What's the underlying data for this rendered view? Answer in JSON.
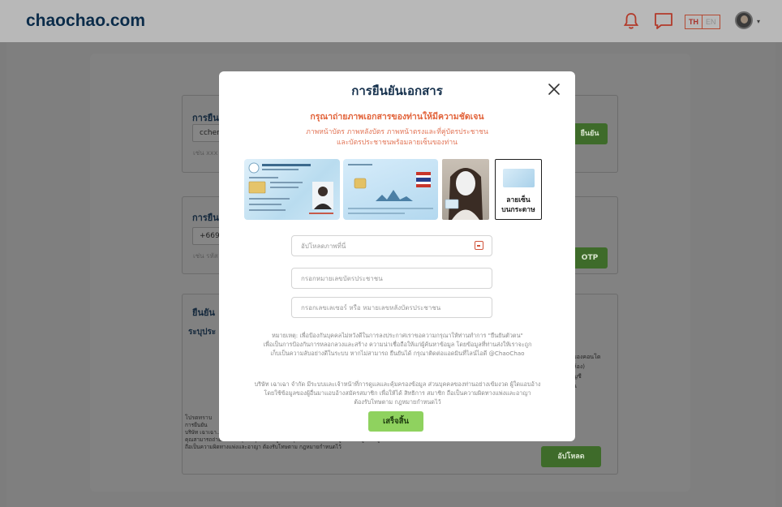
{
  "header": {
    "logo": "chaochao.com",
    "icons": [
      "bell-icon",
      "chat-icon"
    ],
    "lang_th": "TH",
    "lang_en": "EN"
  },
  "background": {
    "section_1_title": "การยืน",
    "section_1_input": "ccher",
    "section_1_hint": "เช่น xxx",
    "section_1_button": "ยืนยัน",
    "section_2_title": "การยืน",
    "section_2_input": "+669",
    "section_2_hint": "เช่น รหัส",
    "section_2_button": "OTP",
    "section_3_title": "ยืนยัน",
    "section_3_subtitle": "ระบุประ",
    "section_3_side": [
      "ของคอนโด",
      "ห้อง)",
      "ญชี",
      "น"
    ],
    "section_3_note_lead": "โปรดทราบ",
    "section_3_footer": [
      "การยืนยัน",
      "บริษัท เฉาเฉา...",
      "คุณสามารถถ่ายเป็นปามพุ่มหาคุยรองข้อมูลส่วนบุคคลให้ได้ และหากผู้ใดนำข้อมูลของผู้อื่นมาแอบอ้าง",
      "ถือเป็นความผิดทางแพ่งและอาญา ต้องรับโทษตาม กฎหมายกำหนดไว้"
    ],
    "upload_button": "อัปโหลด"
  },
  "modal": {
    "title": "การยืนยันเอกสาร",
    "subtitle": "กรุณาถ่ายภาพเอกสารของท่านให้มีความชัดเจน",
    "description_lines": [
      "ภาพหน้าบัตร ภาพหลังบัตร ภาพหน้าตรงและที่คู่บัตรประชาชน",
      "และบัตรประชาชนพร้อมลายเซ็นของท่าน"
    ],
    "signature_label_lines": [
      "ลายเซ็น",
      "บนกระดาษ"
    ],
    "upload_placeholder": "อัปโหลดภาพที่นี่",
    "id_placeholder": "กรอกหมายเลขบัตรประชาชน",
    "laser_placeholder": "กรอกเลขเลเซอร์ หรือ หมายเลขหลังบัตรประชาชน",
    "note_1_lines": [
      "หมายเหตุ: เพื่อป้องกันบุคคลไม่หวังดีในการลงประกาศเราขอความกรุณาให้ท่านทำการ \"ยืนยันตัวตน\"",
      "เพื่อเป็นการป้องกันการหลอกลวงและสร้าง ความน่าเชื่อถือให้แก่ผู้ค้นหาข้อมูล โดยข้อมูลที่ท่านส่งให้เราจะถูก",
      "เก็บเป็นความลับอย่างดีในระบบ หากไม่สามารถ ยืนยันได้ กรุณาติดต่อแอดมินที่ไลน์ไอดี @ChaoChao"
    ],
    "note_2_lines": [
      "บริษัท เฉาเฉา จำกัด มีระบบและเจ้าหน้าที่การดูแลและคุ้มครองข้อมูล ส่วนบุคคลของท่านอย่างเข้มงวด ผู้ใดแอบอ้าง",
      "โดยใช้ข้อมูลของผู้อื่นมาแอบอ้างสมัครสมาชิก เพื่อให้ได้ สิทธิการ สมาชิก ถือเป็นความผิดทางแพ่งและอาญา",
      "ต้องรับโทษตาม กฎหมายกำหนดไว้"
    ],
    "done_button": "เสร็จสิ้น"
  }
}
